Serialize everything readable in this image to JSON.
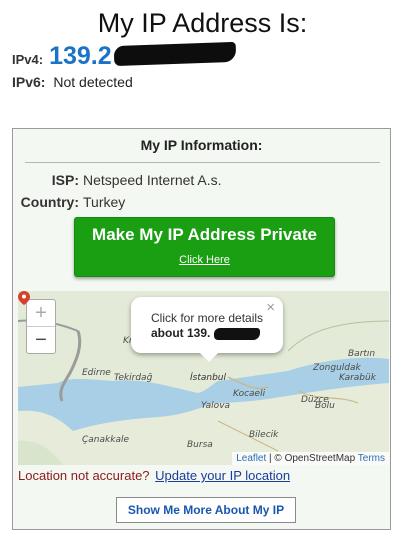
{
  "header": {
    "title": "My IP Address Is:",
    "ipv4_label": "IPv4:",
    "ipv4_value": "139.2",
    "ipv6_label": "IPv6:",
    "ipv6_value": "Not detected"
  },
  "panel": {
    "title": "My IP Information:",
    "isp_label": "ISP:",
    "isp_value": "Netspeed Internet A.s.",
    "country_label": "Country:",
    "country_value": "Turkey",
    "cta_label": "Make My IP Address Private",
    "cta_link": "Click Here"
  },
  "map": {
    "zoom_in": "+",
    "zoom_out": "−",
    "popup_line1": "Click for more details",
    "popup_line2": "about 139.",
    "popup_close": "×",
    "labels": [
      "Kı",
      "Edirne",
      "Tekirdağ",
      "İstanbul",
      "Kocaeli",
      "Yalova",
      "Düzce",
      "Zonguldak",
      "Karabük",
      "Bartın",
      "Bolu",
      "Bilecik",
      "Bursa",
      "Çanakkale"
    ],
    "attribution_leaflet": "Leaflet",
    "attribution_sep": " | © OpenStreetMap ",
    "attribution_terms": "Terms",
    "colors": {
      "water": "#a9cfe6",
      "land": "#e3ead7",
      "border": "#8a8a8a",
      "marker": "#d6412b"
    }
  },
  "location_note": "Location not accurate?",
  "location_link": "Update your IP location",
  "more_button": "Show Me More About My IP",
  "colors": {
    "accent_blue": "#1a73c4",
    "cta_green": "#1a9e12"
  }
}
